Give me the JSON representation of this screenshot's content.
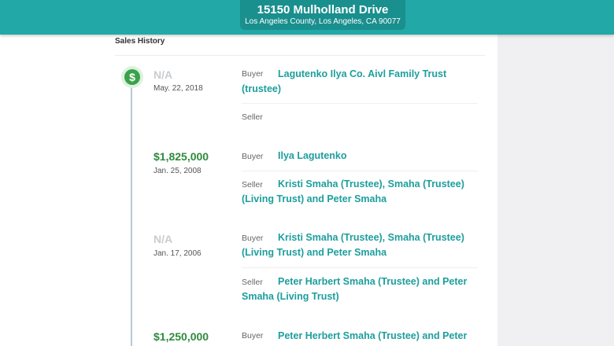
{
  "header": {
    "address": "15150 Mulholland Drive",
    "location": "Los Angeles County, Los Angeles, CA 90077"
  },
  "section_title": "Sales History",
  "icons": {
    "timeline": "dollar-icon",
    "timeline_glyph": "$"
  },
  "labels": {
    "buyer": "Buyer",
    "seller": "Seller"
  },
  "sales": [
    {
      "price": "N/A",
      "date": "May. 22, 2018",
      "buyer": "Lagutenko Ilya Co. Aivl Family Trust (trustee)",
      "seller": ""
    },
    {
      "price": "$1,825,000",
      "date": "Jan. 25, 2008",
      "buyer": "Ilya Lagutenko",
      "seller": "Kristi Smaha (Trustee), Smaha (Trustee) (Living Trust) and Peter Smaha"
    },
    {
      "price": "N/A",
      "date": "Jan. 17, 2006",
      "buyer": "Kristi Smaha (Trustee), Smaha (Trustee) (Living Trust) and Peter Smaha",
      "seller": "Peter Harbert Smaha (Trustee) and Peter Smaha (Living Trust)"
    },
    {
      "price": "$1,250,000",
      "date": "",
      "buyer": "Peter Herbert Smaha (Trustee) and Peter",
      "seller": ""
    }
  ],
  "colors": {
    "header": "#21a8a7",
    "address_box": "#198f8e",
    "link": "#1d9e9d",
    "price": "#2e8b3d",
    "na": "#c9cdd1",
    "timeline": "#b7c9d9"
  }
}
